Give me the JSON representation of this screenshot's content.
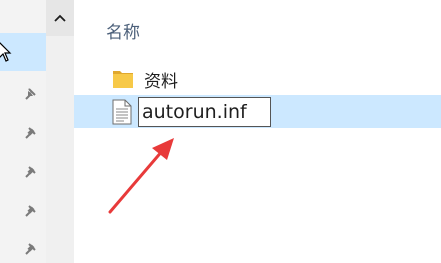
{
  "header": {
    "name_column_label": "名称"
  },
  "files": [
    {
      "name": "资料",
      "icon": "folder-icon"
    },
    {
      "name": "autorun.inf",
      "icon": "text-file-icon",
      "renaming": true
    }
  ],
  "colors": {
    "selection": "#cce8ff",
    "annotation_arrow": "#e83a3a",
    "folder": "#f7c948"
  }
}
